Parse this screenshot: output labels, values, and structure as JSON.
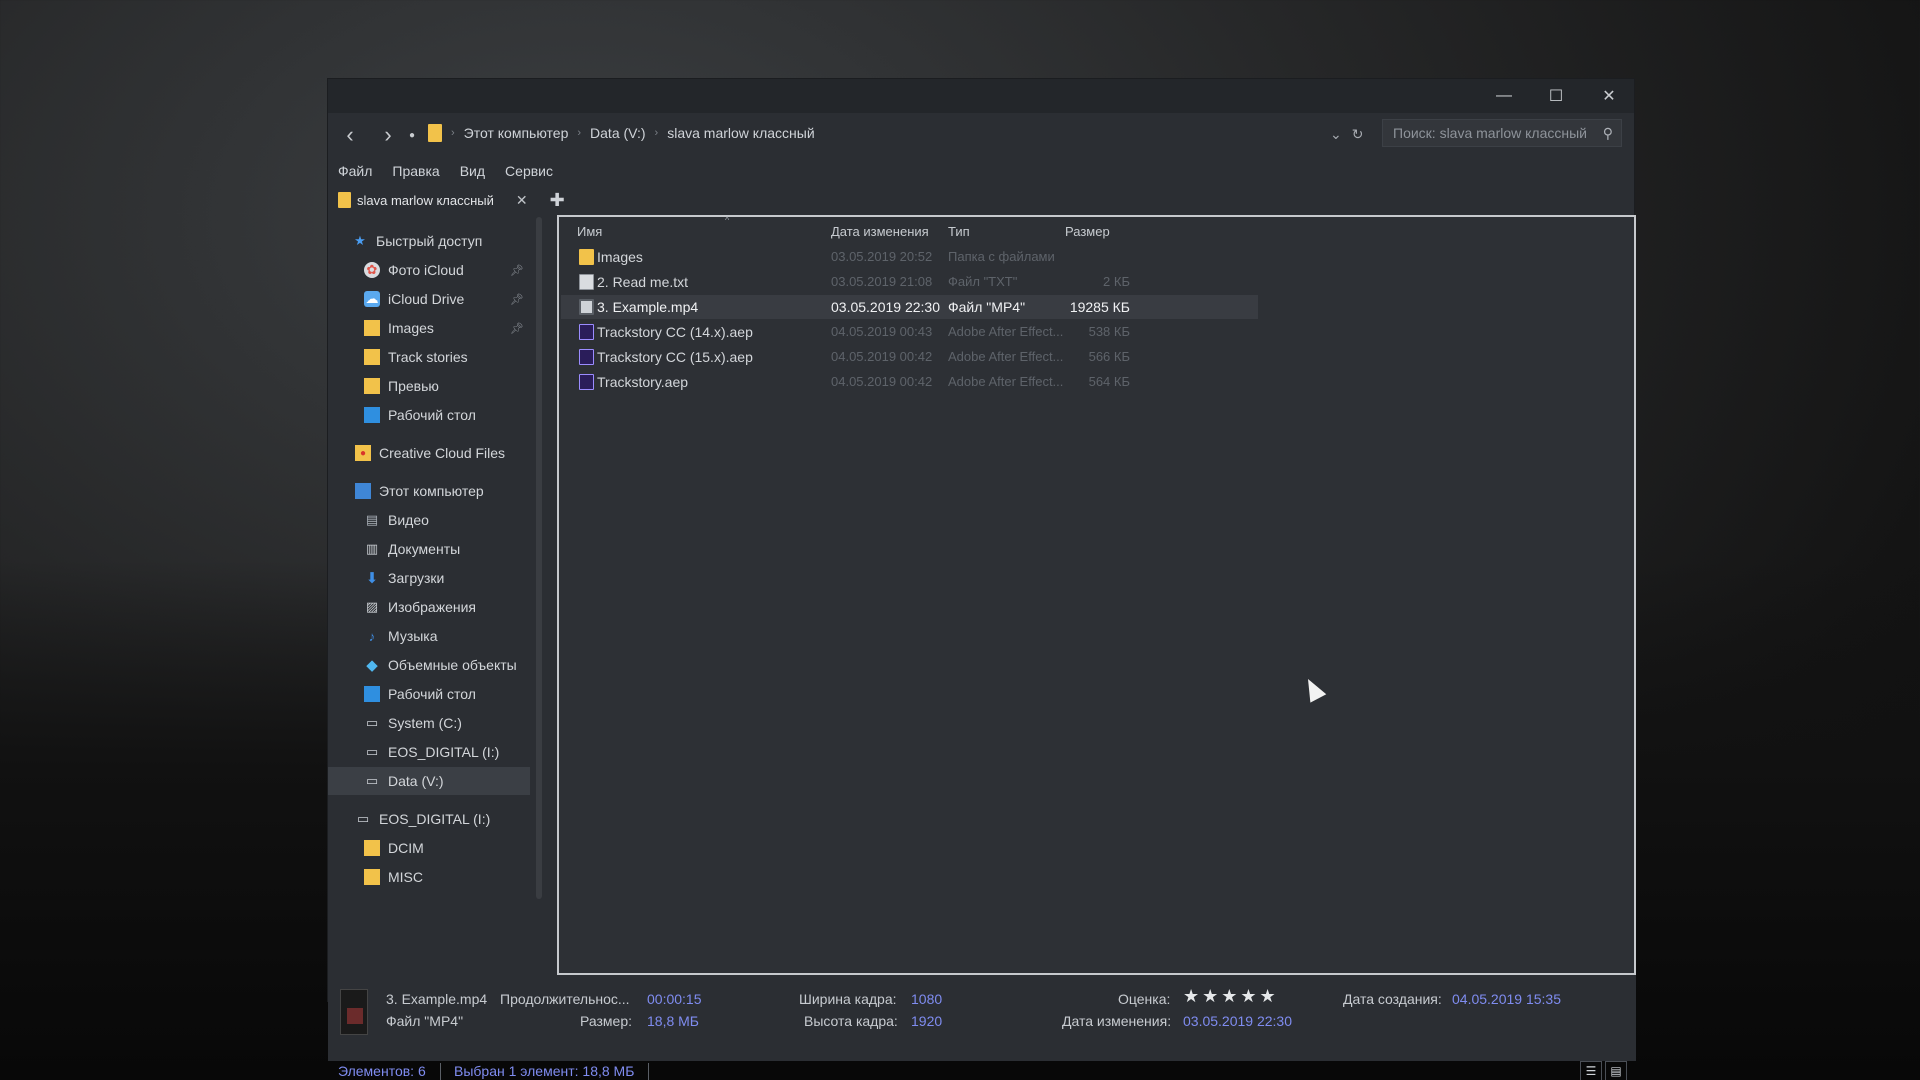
{
  "window": {
    "controls": {
      "minimize": "—",
      "maximize": "☐",
      "close": "✕"
    }
  },
  "address": {
    "back": "‹",
    "forward": "›",
    "crumbs": [
      "Этот компьютер",
      "Data (V:)",
      "slava marlow классный"
    ],
    "separator": "›",
    "dropdown": "⌄",
    "refresh": "↻",
    "search_placeholder": "Поиск: slava marlow классный"
  },
  "menu": [
    "Файл",
    "Правка",
    "Вид",
    "Сервис"
  ],
  "tabs": {
    "active_label": "slava marlow классный",
    "close": "✕",
    "add": "✚"
  },
  "nav": {
    "quick_access": "Быстрый доступ",
    "items_quick": [
      {
        "label": "Фото iCloud",
        "icon": "icloud-photos-icon",
        "pinned": true
      },
      {
        "label": "iCloud Drive",
        "icon": "icloud-drive-icon",
        "pinned": true
      },
      {
        "label": "Images",
        "icon": "folder-icon",
        "pinned": true
      },
      {
        "label": "Track stories",
        "icon": "folder-icon"
      },
      {
        "label": "Превью",
        "icon": "folder-icon"
      },
      {
        "label": "Рабочий стол",
        "icon": "desktop-icon"
      }
    ],
    "creative_cloud": "Creative Cloud Files",
    "this_pc": "Этот компьютер",
    "items_pc": [
      {
        "label": "Видео",
        "icon": "video-icon"
      },
      {
        "label": "Документы",
        "icon": "documents-icon"
      },
      {
        "label": "Загрузки",
        "icon": "downloads-icon"
      },
      {
        "label": "Изображения",
        "icon": "pictures-icon"
      },
      {
        "label": "Музыка",
        "icon": "music-icon"
      },
      {
        "label": "Объемные объекты",
        "icon": "3d-objects-icon"
      },
      {
        "label": "Рабочий стол",
        "icon": "desktop-icon"
      },
      {
        "label": "System (C:)",
        "icon": "drive-icon"
      },
      {
        "label": "EOS_DIGITAL (I:)",
        "icon": "drive-icon"
      },
      {
        "label": "Data (V:)",
        "icon": "drive-icon",
        "selected": true
      }
    ],
    "eos_drive": "EOS_DIGITAL (I:)",
    "items_eos": [
      {
        "label": "DCIM",
        "icon": "folder-icon"
      },
      {
        "label": "MISC",
        "icon": "folder-icon"
      }
    ]
  },
  "columns": {
    "name": "Имя",
    "date": "Дата изменения",
    "type": "Тип",
    "size": "Размер",
    "sort": "^"
  },
  "files": [
    {
      "name": "Images",
      "date": "03.05.2019 20:52",
      "type": "Папка с файлами",
      "size": "",
      "icon": "folder"
    },
    {
      "name": "2. Read me.txt",
      "date": "03.05.2019 21:08",
      "type": "Файл \"TXT\"",
      "size": "2 КБ",
      "icon": "txt"
    },
    {
      "name": "3. Example.mp4",
      "date": "03.05.2019 22:30",
      "type": "Файл \"MP4\"",
      "size": "19285 КБ",
      "icon": "video",
      "selected": true
    },
    {
      "name": "Trackstory CC (14.x).aep",
      "date": "04.05.2019 00:43",
      "type": "Adobe After Effect...",
      "size": "538 КБ",
      "icon": "ae"
    },
    {
      "name": "Trackstory CC (15.x).aep",
      "date": "04.05.2019 00:42",
      "type": "Adobe After Effect...",
      "size": "566 КБ",
      "icon": "ae"
    },
    {
      "name": "Trackstory.aep",
      "date": "04.05.2019 00:42",
      "type": "Adobe After Effect...",
      "size": "564 КБ",
      "icon": "ae"
    }
  ],
  "details": {
    "name": "3. Example.mp4",
    "duration_label": "Продолжительнос...",
    "duration_value": "00:00:15",
    "kind": "Файл \"MP4\"",
    "size_label": "Размер:",
    "size_value": "18,8 МБ",
    "width_label": "Ширина кадра:",
    "width_value": "1080",
    "height_label": "Высота кадра:",
    "height_value": "1920",
    "rating_label": "Оценка:",
    "rating_stars": "★★★★★",
    "rating_value": 5,
    "modified_label": "Дата изменения:",
    "modified_value": "03.05.2019 22:30",
    "created_label": "Дата создания:",
    "created_value": "04.05.2019 15:35"
  },
  "status": {
    "count": "Элементов: 6",
    "selected": "Выбран 1 элемент: 18,8 МБ",
    "view_details": "☰",
    "view_tiles": "▤"
  },
  "colors": {
    "accent_link": "#7f8cf0",
    "folder": "#f2c24a",
    "window_bg": "#2b2e33"
  }
}
